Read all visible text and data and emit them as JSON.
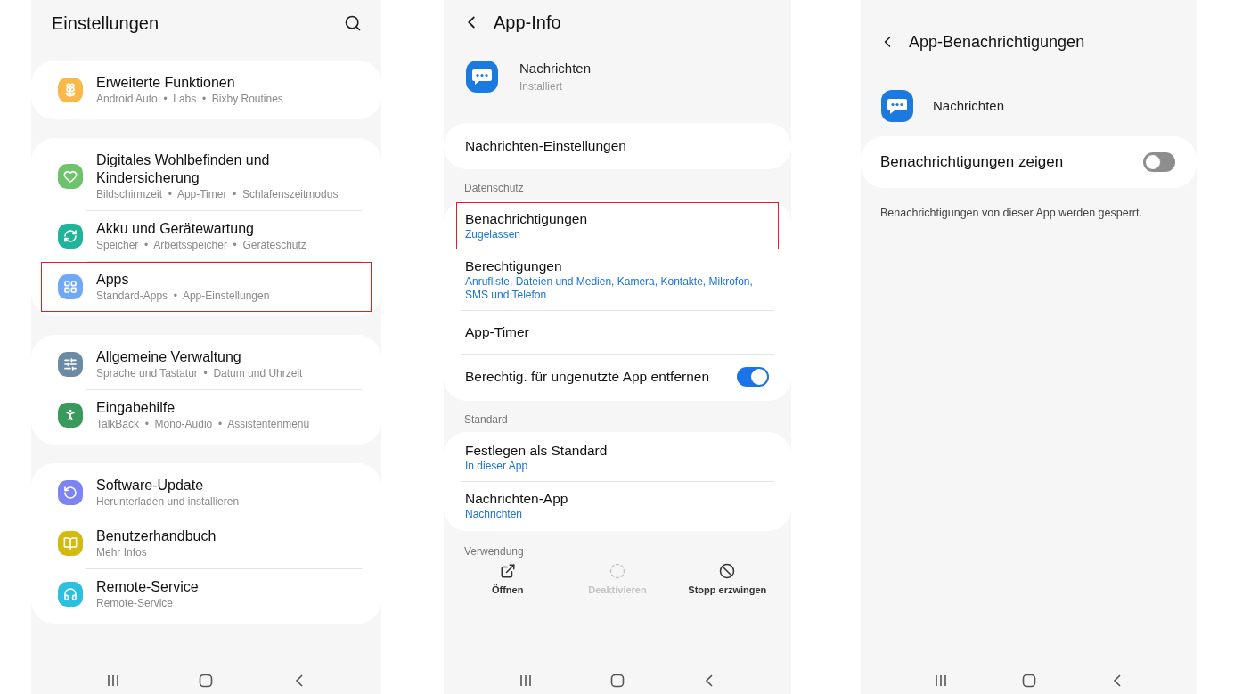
{
  "settings_screen": {
    "title": "Einstellungen",
    "groups": [
      {
        "items": [
          {
            "title": "Erweiterte Funktionen",
            "subtitle": "Android Auto  •  Labs  •  Bixby Routines",
            "color": "#f9b94a",
            "highlighted": false
          }
        ]
      },
      {
        "items": [
          {
            "title": "Digitales Wohlbefinden und Kindersicherung",
            "subtitle": "Bildschirmzeit  •  App-Timer  •  Schlafenszeitmodus",
            "color": "#6cc36b",
            "highlighted": false
          },
          {
            "title": "Akku und Gerätewartung",
            "subtitle": "Speicher  •  Arbeitsspeicher  •  Geräteschutz",
            "color": "#1fb49a",
            "highlighted": false
          },
          {
            "title": "Apps",
            "subtitle": "Standard-Apps  •  App-Einstellungen",
            "color": "#6ea8f7",
            "highlighted": true
          }
        ]
      },
      {
        "items": [
          {
            "title": "Allgemeine Verwaltung",
            "subtitle": "Sprache und Tastatur  •  Datum und Uhrzeit",
            "color": "#6a8aa6",
            "highlighted": false
          },
          {
            "title": "Eingabehilfe",
            "subtitle": "TalkBack  •  Mono-Audio  •  Assistentenmenü",
            "color": "#3a9a5c",
            "highlighted": false
          }
        ]
      },
      {
        "items": [
          {
            "title": "Software-Update",
            "subtitle": "Herunterladen und installieren",
            "color": "#7c83f2",
            "highlighted": false
          },
          {
            "title": "Benutzerhandbuch",
            "subtitle": "Mehr Infos",
            "color": "#d4b90f",
            "highlighted": false
          },
          {
            "title": "Remote-Service",
            "subtitle": "Remote-Service",
            "color": "#2cc0e0",
            "highlighted": false
          }
        ]
      }
    ]
  },
  "app_info_screen": {
    "title": "App-Info",
    "app": {
      "name": "Nachrichten",
      "status": "Installiert"
    },
    "sections": [
      {
        "items": [
          {
            "kind": "link",
            "title": "Nachrichten-Einstellungen",
            "highlighted": false
          }
        ]
      },
      {
        "header": "Datenschutz",
        "items": [
          {
            "kind": "link",
            "title": "Benachrichtigungen",
            "subtitle": "Zugelassen",
            "highlighted": true
          },
          {
            "kind": "link",
            "title": "Berechtigungen",
            "subtitle": "Anrufliste, Dateien und Medien, Kamera, Kontakte, Mikrofon, SMS und Telefon",
            "highlighted": false
          },
          {
            "kind": "link",
            "title": "App-Timer",
            "highlighted": false
          },
          {
            "kind": "toggle",
            "title": "Berechtig. für ungenutzte App entfernen",
            "on": true,
            "highlighted": false
          }
        ]
      },
      {
        "header": "Standard",
        "items": [
          {
            "kind": "link",
            "title": "Festlegen als Standard",
            "subtitle": "In dieser App",
            "highlighted": false
          },
          {
            "kind": "link",
            "title": "Nachrichten-App",
            "subtitle": "Nachrichten",
            "highlighted": false
          }
        ]
      }
    ],
    "usage": {
      "header": "Verwendung",
      "actions": [
        {
          "label": "Öffnen",
          "disabled": false
        },
        {
          "label": "Deaktivieren",
          "disabled": true
        },
        {
          "label": "Stopp erzwingen",
          "disabled": false
        }
      ]
    }
  },
  "notifications_screen": {
    "title": "App-Benachrichtigungen",
    "app": {
      "name": "Nachrichten"
    },
    "toggle": {
      "label": "Benachrichtigungen zeigen",
      "on": false
    },
    "description": "Benachrichtigungen von dieser App werden gesperrt."
  }
}
